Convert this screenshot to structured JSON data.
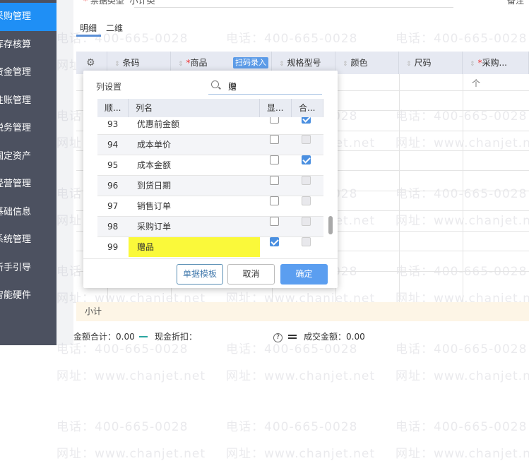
{
  "sidebar": {
    "items": [
      {
        "label": "采购管理",
        "active": true
      },
      {
        "label": "库存核算"
      },
      {
        "label": "资金管理"
      },
      {
        "label": "往账管理"
      },
      {
        "label": "税务管理"
      },
      {
        "label": "固定资产"
      },
      {
        "label": "经营管理"
      },
      {
        "label": "基础信息"
      },
      {
        "label": "系统管理"
      },
      {
        "label": "新手引导"
      },
      {
        "label": "智能硬件"
      }
    ],
    "active_color": "#1f8ff5"
  },
  "form": {
    "field_label": "票据类型",
    "field_value": "小计类",
    "remark_label": "备注"
  },
  "tabs": [
    {
      "label": "明细",
      "active": true
    },
    {
      "label": "二维"
    }
  ],
  "grid": {
    "columns": [
      "条码",
      "商品",
      "规格型号",
      "颜色",
      "尺码",
      "采购..."
    ],
    "scan_button": "扫码录入",
    "first_row_cell": "个",
    "subtotal_label": "小计"
  },
  "footer": {
    "amount_total": "金额合计：0.00",
    "cash_discount": "现金折扣：",
    "deal_amount": "成交金额：0.00"
  },
  "watermark": {
    "phone": "电话：400-665-0028",
    "site": "网址：www.chanjet.net"
  },
  "popup": {
    "title": "列设置",
    "search_value": "赠",
    "headers": [
      "顺...",
      "列名",
      "显...",
      "合..."
    ],
    "rows": [
      {
        "no": "93",
        "name": "优惠前金额",
        "show": false,
        "sum": "on"
      },
      {
        "no": "94",
        "name": "成本单价",
        "show": false,
        "sum": "disabled"
      },
      {
        "no": "95",
        "name": "成本金额",
        "show": false,
        "sum": "on"
      },
      {
        "no": "96",
        "name": "到货日期",
        "show": false,
        "sum": "disabled"
      },
      {
        "no": "97",
        "name": "销售订单",
        "show": false,
        "sum": "disabled"
      },
      {
        "no": "98",
        "name": "采购订单",
        "show": false,
        "sum": "disabled"
      },
      {
        "no": "99",
        "name": "赠品",
        "show": true,
        "sum": "disabled",
        "highlight": true
      }
    ],
    "buttons": {
      "template": "单据模板",
      "cancel": "取消",
      "ok": "确定"
    },
    "ok_color": "#5b9ef0",
    "highlight_color": "#faf93a"
  }
}
